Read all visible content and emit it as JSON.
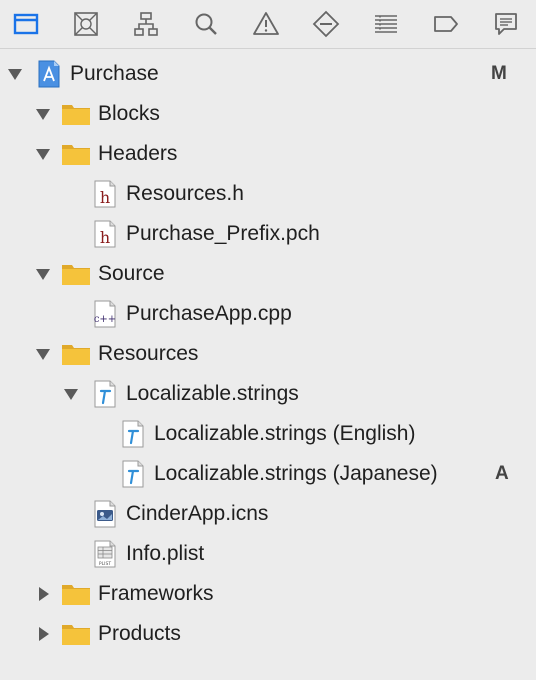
{
  "toolbar": {
    "icons": [
      {
        "name": "folder-navigator-icon"
      },
      {
        "name": "source-control-icon"
      },
      {
        "name": "symbol-hierarchy-icon"
      },
      {
        "name": "search-icon"
      },
      {
        "name": "warning-icon"
      },
      {
        "name": "breakpoint-diamond-icon"
      },
      {
        "name": "debug-list-icon"
      },
      {
        "name": "tag-icon"
      },
      {
        "name": "comment-icon"
      }
    ],
    "active_color": "#1a73e8"
  },
  "tree": {
    "items": [
      {
        "label": "Purchase",
        "badge": "M"
      },
      {
        "label": "Blocks"
      },
      {
        "label": "Headers"
      },
      {
        "label": "Resources.h"
      },
      {
        "label": "Purchase_Prefix.pch"
      },
      {
        "label": "Source"
      },
      {
        "label": "PurchaseApp.cpp"
      },
      {
        "label": "Resources"
      },
      {
        "label": "Localizable.strings"
      },
      {
        "label": "Localizable.strings (English)"
      },
      {
        "label": "Localizable.strings (Japanese)",
        "badge": "A"
      },
      {
        "label": "CinderApp.icns"
      },
      {
        "label": "Info.plist"
      },
      {
        "label": "Frameworks"
      },
      {
        "label": "Products"
      }
    ]
  },
  "colors": {
    "folder": "#f5c33b",
    "folder_dark": "#e0a92a",
    "strings_blue": "#2f8fd8"
  }
}
